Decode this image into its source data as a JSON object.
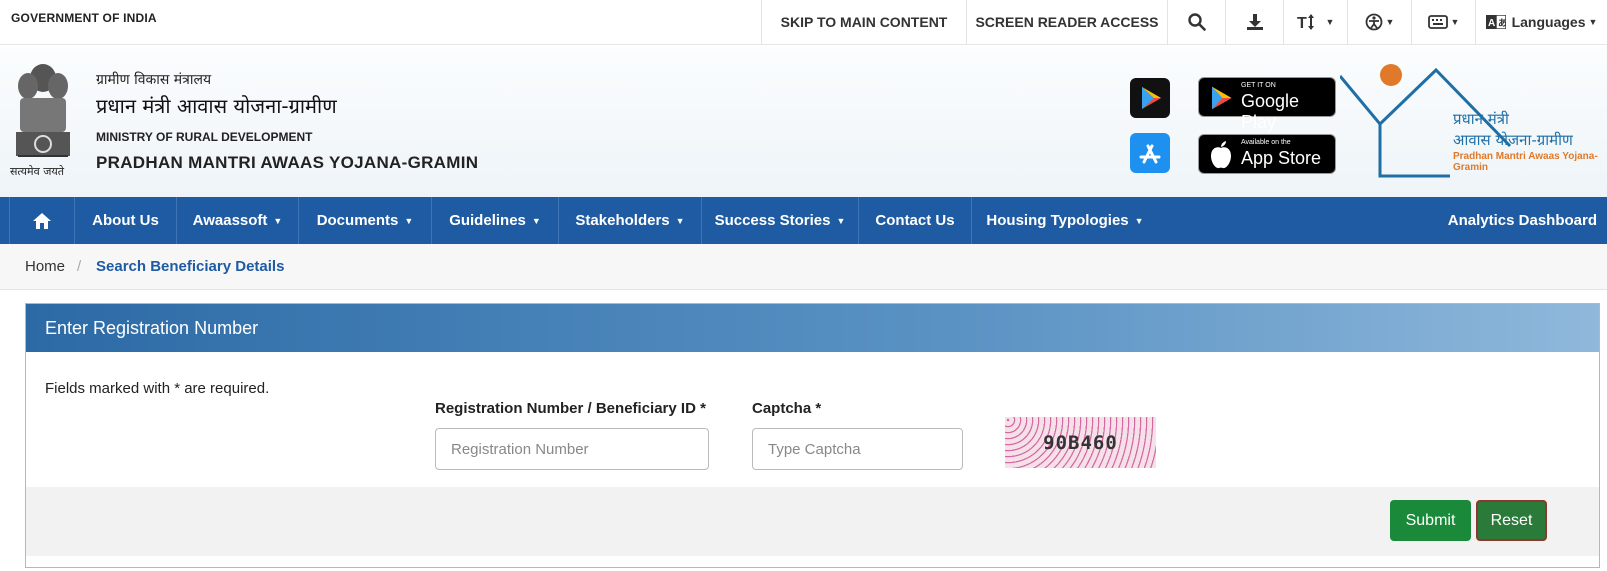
{
  "topbar": {
    "gov_title": "GOVERNMENT OF INDIA",
    "skip_link": "SKIP TO MAIN CONTENT",
    "screen_reader": "SCREEN READER ACCESS",
    "languages": "Languages"
  },
  "header": {
    "emblem_caption": "सत्यमेव जयते",
    "ministry_hindi": "ग्रामीण विकास मंत्रालय",
    "title_hindi": "प्रधान मंत्री आवास योजना-ग्रामीण",
    "ministry_english": "MINISTRY OF RURAL DEVELOPMENT",
    "title_english": "PRADHAN MANTRI AWAAS YOJANA-GRAMIN",
    "google_play_small": "GET IT ON",
    "google_play_big": "Google Play",
    "app_store_small": "Available on the",
    "app_store_big": "App Store",
    "logo_hindi_line1": "प्रधान मंत्री",
    "logo_hindi_line2": "आवास योजना-ग्रामीण",
    "logo_english": "Pradhan Mantri Awaas Yojana-Gramin"
  },
  "nav": {
    "items": [
      {
        "label": "About Us"
      },
      {
        "label": "Awaassoft"
      },
      {
        "label": "Documents"
      },
      {
        "label": "Guidelines"
      },
      {
        "label": "Stakeholders"
      },
      {
        "label": "Success Stories"
      },
      {
        "label": "Contact Us"
      },
      {
        "label": "Housing Typologies"
      }
    ],
    "analytics": "Analytics Dashboard"
  },
  "breadcrumb": {
    "home": "Home",
    "separator": "/",
    "current": "Search Beneficiary Details"
  },
  "form": {
    "panel_title": "Enter Registration Number",
    "required_note": "Fields marked with * are required.",
    "reg_label": "Registration Number / Beneficiary ID *",
    "reg_placeholder": "Registration Number",
    "captcha_label": "Captcha *",
    "captcha_placeholder": "Type Captcha",
    "captcha_text": "90B460",
    "submit_label": "Submit",
    "reset_label": "Reset"
  },
  "colors": {
    "nav_bg": "#1f5ba2",
    "panel_head": "#2c6aa6",
    "submit": "#1a8a3a",
    "logo_orange": "#e07a2a"
  }
}
